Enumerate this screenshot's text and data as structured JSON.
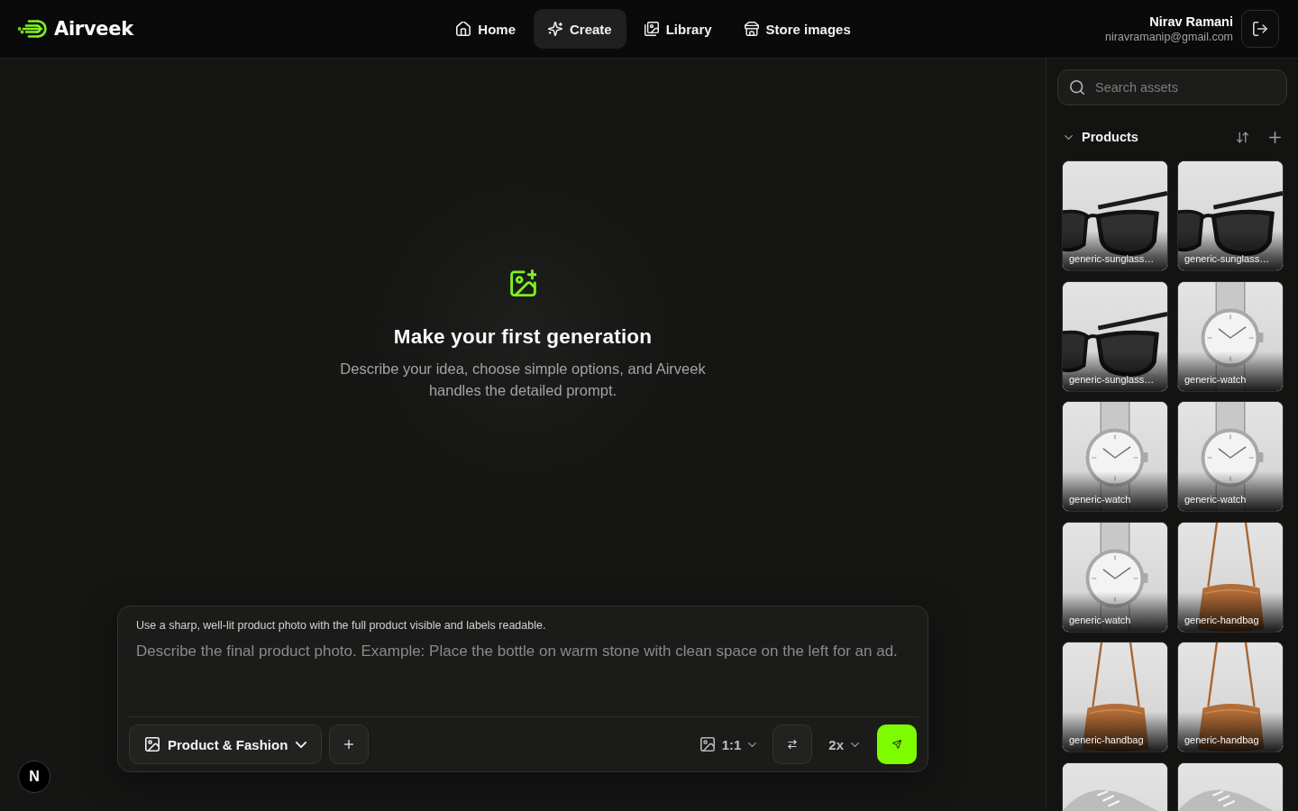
{
  "header": {
    "logo": "Airveek",
    "nav": [
      {
        "kind": "home",
        "label": "Home",
        "selected": false
      },
      {
        "kind": "create",
        "label": "Create",
        "selected": true
      },
      {
        "kind": "library",
        "label": "Library",
        "selected": false
      },
      {
        "kind": "store",
        "label": "Store images",
        "selected": false
      }
    ],
    "user": {
      "name": "Nirav Ramani",
      "email": "niravramanip@gmail.com"
    }
  },
  "empty_state": {
    "title": "Make your first generation",
    "description": "Describe your idea, choose simple options, and Airveek handles the detailed prompt."
  },
  "composer": {
    "hint": "Use a sharp, well-lit product photo with the full product visible and labels readable.",
    "placeholder": "Describe the final product photo. Example: Place the bottle on warm stone with clean space on the left for an ad.",
    "category": "Product & Fashion",
    "aspect_ratio": "1:1",
    "count": "2x"
  },
  "sidebar": {
    "search": {
      "placeholder": "Search assets"
    },
    "section": {
      "title": "Products",
      "expanded": true
    },
    "assets": [
      {
        "kind": "sunglasses",
        "label": "generic-sunglass…"
      },
      {
        "kind": "sunglasses",
        "label": "generic-sunglass…"
      },
      {
        "kind": "sunglasses",
        "label": "generic-sunglass…"
      },
      {
        "kind": "watch",
        "label": "generic-watch"
      },
      {
        "kind": "watch",
        "label": "generic-watch"
      },
      {
        "kind": "watch",
        "label": "generic-watch"
      },
      {
        "kind": "watch",
        "label": "generic-watch"
      },
      {
        "kind": "handbag",
        "label": "generic-handbag"
      },
      {
        "kind": "handbag",
        "label": "generic-handbag"
      },
      {
        "kind": "handbag",
        "label": "generic-handbag"
      },
      {
        "kind": "sneaker"
      },
      {
        "kind": "sneaker"
      }
    ]
  },
  "dev_badge": {
    "label": "N"
  }
}
